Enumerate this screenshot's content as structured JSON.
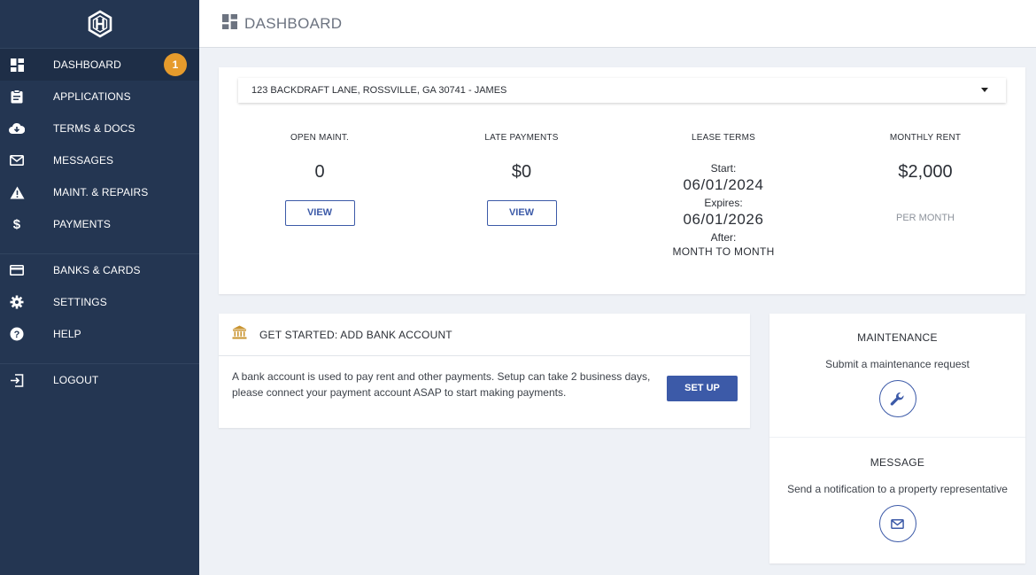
{
  "sidebar": {
    "items": [
      {
        "label": "DASHBOARD",
        "icon": "dashboard-icon",
        "badge": "1"
      },
      {
        "label": "APPLICATIONS",
        "icon": "clipboard-icon"
      },
      {
        "label": "TERMS & DOCS",
        "icon": "cloud-download-icon"
      },
      {
        "label": "MESSAGES",
        "icon": "envelope-icon"
      },
      {
        "label": "MAINT. & REPAIRS",
        "icon": "warning-icon"
      },
      {
        "label": "PAYMENTS",
        "icon": "dollar-icon"
      },
      {
        "label": "BANKS & CARDS",
        "icon": "credit-card-icon"
      },
      {
        "label": "SETTINGS",
        "icon": "gear-icon"
      },
      {
        "label": "HELP",
        "icon": "help-icon"
      },
      {
        "label": "LOGOUT",
        "icon": "logout-icon"
      }
    ]
  },
  "header": {
    "title": "DASHBOARD"
  },
  "property": {
    "selected": "123 BACKDRAFT LANE, ROSSVILLE, GA 30741 - JAMES"
  },
  "stats": {
    "open_maint": {
      "label": "OPEN MAINT.",
      "value": "0",
      "button": "VIEW"
    },
    "late_payments": {
      "label": "LATE PAYMENTS",
      "value": "$0",
      "button": "VIEW"
    },
    "lease_terms": {
      "label": "LEASE TERMS",
      "start_label": "Start:",
      "start": "06/01/2024",
      "expires_label": "Expires:",
      "expires": "06/01/2026",
      "after_label": "After:",
      "after": "MONTH TO MONTH"
    },
    "monthly_rent": {
      "label": "MONTHLY RENT",
      "value": "$2,000",
      "sub": "PER MONTH"
    }
  },
  "bank": {
    "title": "GET STARTED: ADD BANK ACCOUNT",
    "text": "A bank account is used to pay rent and other payments. Setup can take 2 business days, please connect your payment account ASAP to start making payments.",
    "button": "SET UP"
  },
  "maintenance": {
    "title": "MAINTENANCE",
    "subtitle": "Submit a maintenance request"
  },
  "message": {
    "title": "MESSAGE",
    "subtitle": "Send a notification to a property representative"
  },
  "colors": {
    "sidebar": "#243652",
    "accent": "#3c5aa8",
    "badge": "#e69b2c",
    "background": "#eef1f6"
  }
}
